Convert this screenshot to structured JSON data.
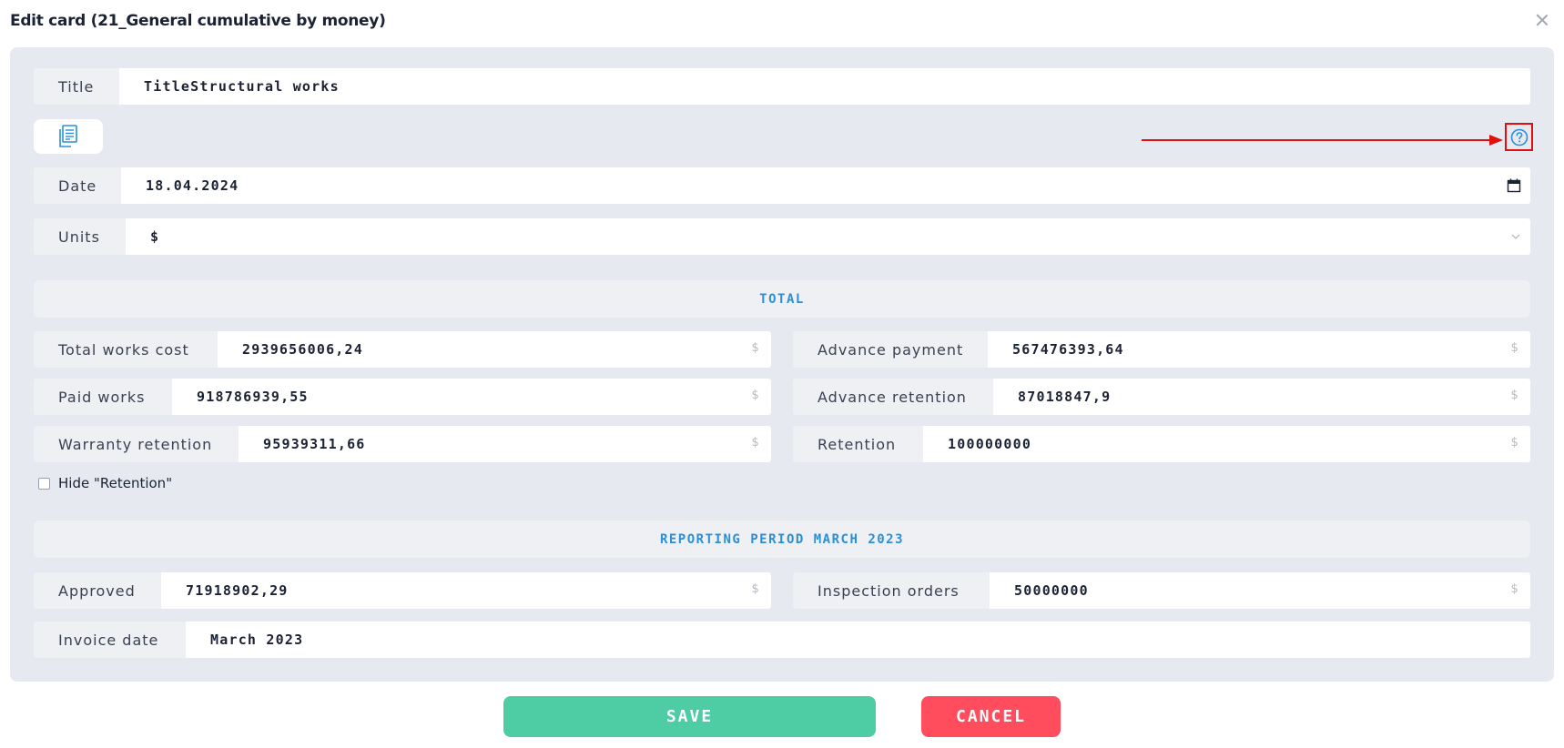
{
  "modal": {
    "title": "Edit card (21_General cumulative by money)"
  },
  "fields": {
    "title": {
      "label": "Title",
      "value": "TitleStructural works"
    },
    "date": {
      "label": "Date",
      "value": "18.04.2024"
    },
    "units": {
      "label": "Units",
      "value": "$"
    }
  },
  "total": {
    "heading": "TOTAL",
    "unit": "$",
    "total_works_cost": {
      "label": "Total works cost",
      "value": "2939656006,24"
    },
    "advance_payment": {
      "label": "Advance payment",
      "value": "567476393,64"
    },
    "paid_works": {
      "label": "Paid works",
      "value": "918786939,55"
    },
    "advance_retention": {
      "label": "Advance retention",
      "value": "87018847,9"
    },
    "warranty_retention": {
      "label": "Warranty retention",
      "value": "95939311,66"
    },
    "retention": {
      "label": "Retention",
      "value": "100000000"
    }
  },
  "hide_retention": {
    "label": "Hide \"Retention\"",
    "checked": false
  },
  "reporting": {
    "heading": "REPORTING PERIOD MARCH 2023",
    "approved": {
      "label": "Approved",
      "value": "71918902,29"
    },
    "inspection_orders": {
      "label": "Inspection orders",
      "value": "50000000"
    },
    "invoice_date": {
      "label": "Invoice date",
      "value": "March 2023"
    }
  },
  "actions": {
    "save_label": "SAVE",
    "cancel_label": "CANCEL"
  },
  "icons": {
    "close": "close-icon",
    "document": "document-icon",
    "help": "help-circle-icon",
    "calendar": "calendar-icon",
    "chevron": "chevron-down-icon"
  },
  "colors": {
    "accent": "#2b8fd6",
    "save": "#4ecca3",
    "cancel": "#ff4d5e",
    "panel": "#e6e9f0",
    "annotation": "#e01010"
  }
}
